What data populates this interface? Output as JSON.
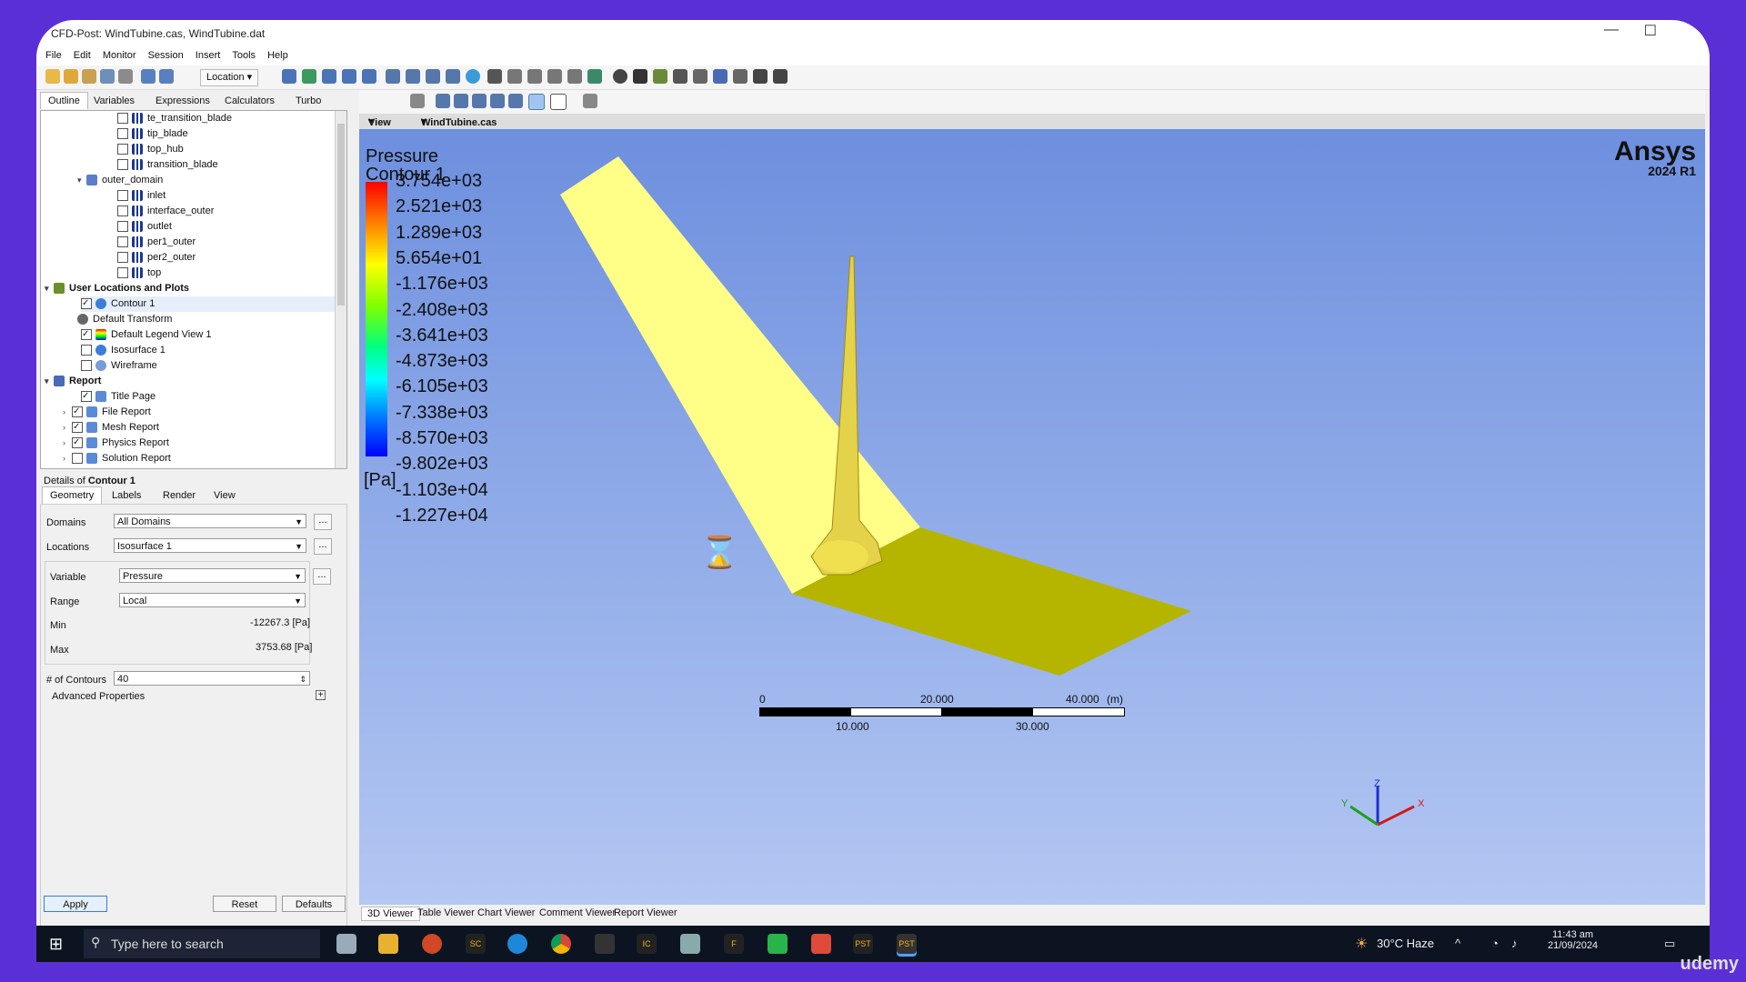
{
  "window": {
    "title": "CFD-Post: WindTubine.cas, WindTubine.dat"
  },
  "menu": [
    "File",
    "Edit",
    "Monitor",
    "Session",
    "Insert",
    "Tools",
    "Help"
  ],
  "toolbar": {
    "location_label": "Location"
  },
  "left_tabs": [
    "Outline",
    "Variables",
    "Expressions",
    "Calculators",
    "Turbo"
  ],
  "tree": {
    "rows": [
      {
        "label": "te_transition_blade",
        "type": "boundary",
        "checked": false,
        "level": 3
      },
      {
        "label": "tip_blade",
        "type": "boundary",
        "checked": false,
        "level": 3
      },
      {
        "label": "top_hub",
        "type": "boundary",
        "checked": false,
        "level": 3
      },
      {
        "label": "transition_blade",
        "type": "boundary",
        "checked": false,
        "level": 3
      },
      {
        "label": "outer_domain",
        "type": "domain",
        "level": 2,
        "expanded": true
      },
      {
        "label": "inlet",
        "type": "boundary",
        "checked": false,
        "level": 3
      },
      {
        "label": "interface_outer",
        "type": "boundary",
        "checked": false,
        "level": 3
      },
      {
        "label": "outlet",
        "type": "boundary",
        "checked": false,
        "level": 3
      },
      {
        "label": "per1_outer",
        "type": "boundary",
        "checked": false,
        "level": 3
      },
      {
        "label": "per2_outer",
        "type": "boundary",
        "checked": false,
        "level": 3
      },
      {
        "label": "top",
        "type": "boundary",
        "checked": false,
        "level": 3
      },
      {
        "label": "User Locations and Plots",
        "type": "folder",
        "level": 0,
        "expanded": true
      },
      {
        "label": "Contour 1",
        "type": "object",
        "checked": true,
        "level": 1
      },
      {
        "label": "Default Transform",
        "type": "object",
        "level": 1
      },
      {
        "label": "Default Legend View 1",
        "type": "object",
        "checked": true,
        "level": 1
      },
      {
        "label": "Isosurface 1",
        "type": "object",
        "checked": false,
        "level": 1
      },
      {
        "label": "Wireframe",
        "type": "object",
        "checked": false,
        "level": 1
      },
      {
        "label": "Report",
        "type": "folder",
        "level": 0,
        "expanded": true
      },
      {
        "label": "Title Page",
        "type": "object",
        "checked": true,
        "level": 1
      },
      {
        "label": "File Report",
        "type": "object",
        "checked": true,
        "level": 1
      },
      {
        "label": "Mesh Report",
        "type": "object",
        "checked": true,
        "level": 1
      },
      {
        "label": "Physics Report",
        "type": "object",
        "checked": true,
        "level": 1
      },
      {
        "label": "Solution Report",
        "type": "object",
        "checked": false,
        "level": 1
      }
    ]
  },
  "details": {
    "title_prefix": "Details of",
    "title_object": "Contour 1",
    "tabs": [
      "Geometry",
      "Labels",
      "Render",
      "View"
    ],
    "domains_label": "Domains",
    "domains_value": "All Domains",
    "locations_label": "Locations",
    "locations_value": "Isosurface 1",
    "variable_label": "Variable",
    "variable_value": "Pressure",
    "range_label": "Range",
    "range_value": "Local",
    "min_label": "Min",
    "min_value": "-12267.3 [Pa]",
    "max_label": "Max",
    "max_value": "3753.68 [Pa]",
    "contours_label": "# of Contours",
    "contours_value": "40",
    "advanced_label": "Advanced Properties",
    "apply": "Apply",
    "reset": "Reset",
    "defaults": "Defaults",
    "dots": "..."
  },
  "viewer": {
    "view_name": "View 1",
    "file_name": "WindTubine.cas",
    "legend_title": "Pressure",
    "legend_subtitle": "Contour 1",
    "legend_values": [
      "3.754e+03",
      "2.521e+03",
      "1.289e+03",
      "5.654e+01",
      "-1.176e+03",
      "-2.408e+03",
      "-3.641e+03",
      "-4.873e+03",
      "-6.105e+03",
      "-7.338e+03",
      "-8.570e+03",
      "-9.802e+03",
      "-1.103e+04",
      "-1.227e+04"
    ],
    "legend_unit": "[Pa]",
    "brand": "Ansys",
    "version": "2024 R1",
    "scale_top": [
      "0",
      "20.000",
      "40.000"
    ],
    "scale_unit": "(m)",
    "scale_bottom": [
      "10.000",
      "30.000"
    ],
    "axes": {
      "x": "X",
      "y": "Y",
      "z": "Z"
    },
    "tabs": [
      "3D Viewer",
      "Table Viewer",
      "Chart Viewer",
      "Comment Viewer",
      "Report Viewer"
    ]
  },
  "taskbar": {
    "search_placeholder": "Type here to search",
    "weather": "30°C  Haze",
    "time": "11:43 am",
    "date": "21/09/2024",
    "app_labels": [
      "SC",
      "IC",
      "F",
      "PST",
      "PST"
    ]
  },
  "watermark": "udemy"
}
